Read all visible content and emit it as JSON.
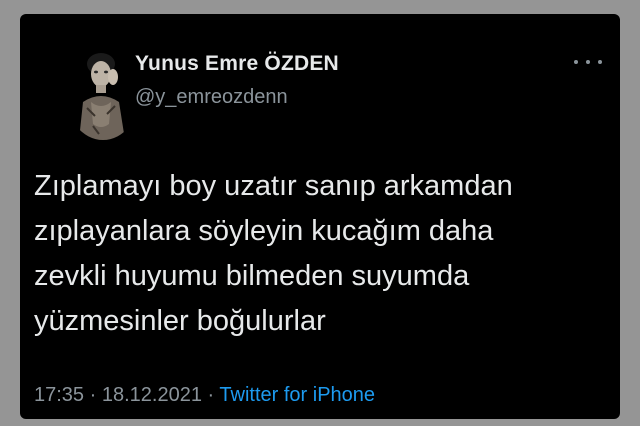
{
  "author": {
    "name": "Yunus Emre ÖZDEN",
    "handle": "@y_emreozdenn"
  },
  "tweet": {
    "lines": [
      "Zıplamayı boy uzatır sanıp arkamdan",
      "zıplayanlara söyleyin kucağım daha",
      "zevkli huyumu bilmeden suyumda",
      "yüzmesinler boğulurlar"
    ],
    "time": "17:35",
    "separator": "·",
    "date": "18.12.2021",
    "source": "Twitter for iPhone"
  },
  "colors": {
    "card_background": "#000000",
    "primary_text": "#e7e9ea",
    "secondary_text": "#8b949b",
    "link": "#1d9bf0"
  },
  "icons": {
    "more": "more-horizontal-icon"
  }
}
